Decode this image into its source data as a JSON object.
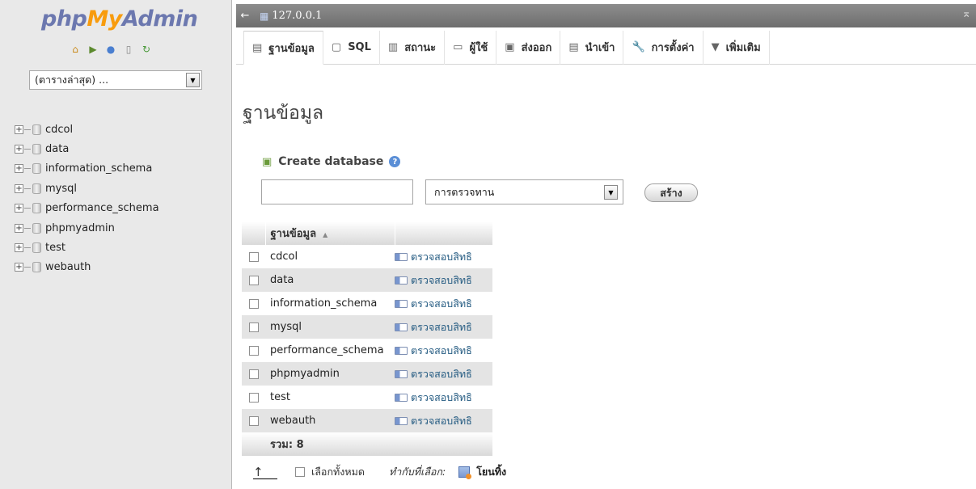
{
  "navigation": {
    "logo": {
      "php": "php",
      "my": "My",
      "admin": "Admin"
    },
    "icons": [
      "home-icon",
      "logout-icon",
      "help-icon",
      "docs-icon",
      "reload-icon"
    ],
    "recent_select": "(ตารางล่าสุด) ...",
    "databases": [
      "cdcol",
      "data",
      "information_schema",
      "mysql",
      "performance_schema",
      "phpmyadmin",
      "test",
      "webauth"
    ]
  },
  "topbar": {
    "server": "127.0.0.1"
  },
  "tabs": [
    {
      "label": "ฐานข้อมูล",
      "icon": "database-icon",
      "glyph": "▤"
    },
    {
      "label": "SQL",
      "icon": "sql-icon",
      "glyph": "▢"
    },
    {
      "label": "สถานะ",
      "icon": "status-icon",
      "glyph": "▥"
    },
    {
      "label": "ผู้ใช้",
      "icon": "users-icon",
      "glyph": "▭"
    },
    {
      "label": "ส่งออก",
      "icon": "export-icon",
      "glyph": "▣"
    },
    {
      "label": "นำเข้า",
      "icon": "import-icon",
      "glyph": "▤"
    },
    {
      "label": "การตั้งค่า",
      "icon": "wrench-icon",
      "glyph": "🔧"
    },
    {
      "label": "เพิ่มเติม",
      "icon": "chevron-down-icon",
      "glyph": "▼"
    }
  ],
  "main": {
    "title": "ฐานข้อมูล",
    "create": {
      "heading": "Create database",
      "name_value": "",
      "collation": "การตรวจทาน",
      "button": "สร้าง"
    },
    "table": {
      "header": "ฐานข้อมูล",
      "rows": [
        {
          "name": "cdcol",
          "action": "ตรวจสอบสิทธิ"
        },
        {
          "name": "data",
          "action": "ตรวจสอบสิทธิ"
        },
        {
          "name": "information_schema",
          "action": "ตรวจสอบสิทธิ"
        },
        {
          "name": "mysql",
          "action": "ตรวจสอบสิทธิ"
        },
        {
          "name": "performance_schema",
          "action": "ตรวจสอบสิทธิ"
        },
        {
          "name": "phpmyadmin",
          "action": "ตรวจสอบสิทธิ"
        },
        {
          "name": "test",
          "action": "ตรวจสอบสิทธิ"
        },
        {
          "name": "webauth",
          "action": "ตรวจสอบสิทธิ"
        }
      ],
      "total": "รวม: 8"
    },
    "bottom": {
      "check_all": "เลือกทั้งหมด",
      "with_selected": "ทำกับที่เลือก:",
      "drop": "โยนทิ้ง"
    }
  }
}
